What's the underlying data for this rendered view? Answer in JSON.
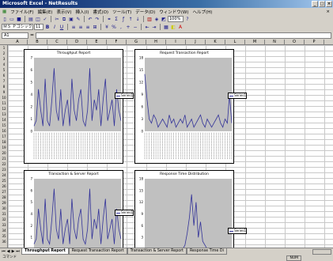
{
  "window": {
    "title": "Microsoft Excel - NetResults"
  },
  "menu": {
    "items": [
      "ファイル(F)",
      "編集(E)",
      "表示(V)",
      "挿入(I)",
      "書式(O)",
      "ツール(T)",
      "データ(D)",
      "ウィンドウ(W)",
      "ヘルプ(H)"
    ]
  },
  "toolbar": {
    "zoom": "100%",
    "font_name": "ＭＳ Ｐゴシック",
    "font_size": "11"
  },
  "formula_bar": {
    "name_box": "A1",
    "fx": "="
  },
  "columns": [
    "A",
    "B",
    "C",
    "D",
    "E",
    "F",
    "G",
    "H",
    "I",
    "J",
    "K",
    "L",
    "M",
    "N",
    "O",
    "P"
  ],
  "rows": [
    "1",
    "2",
    "3",
    "4",
    "5",
    "6",
    "7",
    "8",
    "9",
    "10",
    "11",
    "12",
    "13",
    "14",
    "15",
    "16",
    "17",
    "18",
    "19",
    "20",
    "21",
    "22",
    "23",
    "24",
    "25",
    "26",
    "27",
    "28",
    "29",
    "30",
    "31",
    "32",
    "33",
    "34",
    "35",
    "36"
  ],
  "sheets": {
    "tabs": [
      "Throughput Report",
      "Request Transaction Report",
      "Transaction & Server Report",
      "Response Time Di"
    ],
    "active": 0
  },
  "status": {
    "ready": "コマンド",
    "num": "NUM"
  },
  "chart_data": [
    {
      "type": "line",
      "title": "Throughput Report",
      "ylim": [
        0,
        7
      ],
      "series": [
        {
          "name": "Series1",
          "values": [
            0.5,
            1,
            4,
            2,
            0.5,
            5,
            1,
            0.5,
            3,
            6,
            2,
            1,
            4,
            0.5,
            2,
            3,
            0.5,
            5,
            2,
            1,
            3,
            4,
            1,
            0.5,
            2,
            6,
            1,
            3,
            2,
            4,
            0.5,
            3,
            5,
            1,
            2,
            3,
            0.5,
            4,
            2,
            1
          ]
        }
      ],
      "legend": "right"
    },
    {
      "type": "line",
      "title": "Request Transaction Report",
      "ylim": [
        0,
        18
      ],
      "series": [
        {
          "name": "Series1",
          "values": [
            14,
            8,
            3,
            2,
            4,
            3,
            1,
            2,
            3,
            2,
            1,
            4,
            2,
            3,
            1,
            2,
            3,
            2,
            4,
            1,
            2,
            3,
            1,
            2,
            3,
            4,
            2,
            1,
            3,
            2,
            1,
            2,
            3,
            4,
            2,
            1,
            3,
            2,
            9,
            2
          ]
        }
      ],
      "legend": "right"
    },
    {
      "type": "line",
      "title": "Transaction & Server Report",
      "ylim": [
        0,
        7
      ],
      "series": [
        {
          "name": "Series1",
          "values": [
            0.5,
            1,
            4,
            2,
            0.5,
            5,
            1,
            0.5,
            3,
            6,
            2,
            1,
            4,
            0.5,
            2,
            3,
            0.5,
            5,
            2,
            1,
            3,
            4,
            1,
            0.5,
            2,
            6,
            1,
            3,
            2,
            4,
            0.5,
            3,
            5,
            1,
            2,
            3,
            0.5,
            4,
            2,
            1
          ]
        }
      ],
      "legend": "right"
    },
    {
      "type": "line",
      "title": "Response Time Distribution",
      "ylim": [
        0,
        18
      ],
      "series": [
        {
          "name": "Series1",
          "values": [
            0,
            0,
            0,
            0,
            0,
            0,
            0,
            0,
            0,
            0,
            0,
            0,
            0,
            0,
            0,
            0,
            0,
            0,
            1,
            4,
            8,
            14,
            6,
            12,
            3,
            7,
            2,
            1,
            0,
            0,
            0,
            0,
            0,
            0,
            0,
            0,
            0,
            0,
            0,
            0
          ]
        }
      ],
      "legend": "right"
    }
  ],
  "legend_label": "Series1"
}
